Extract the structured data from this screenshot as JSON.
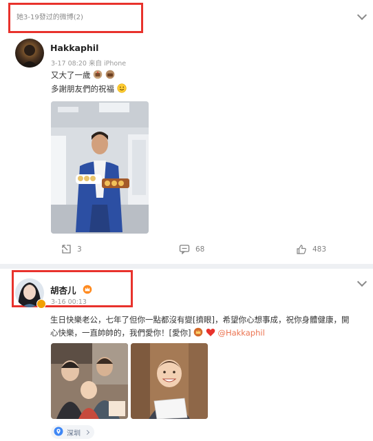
{
  "group": {
    "header": "她3-19發过的微博(2)"
  },
  "post1": {
    "username": "Hakkaphil",
    "meta": "3-17 08:20  来自 iPhone",
    "line1": "又大了一歲",
    "line2": "多謝朋友們的祝福",
    "repost_count": "3",
    "comment_count": "68",
    "like_count": "483"
  },
  "post2": {
    "username": "胡杏儿",
    "meta": "3-16 00:13",
    "line1": "生日快樂老公，七年了但你一點都沒有變[擠眼]，希望你心想事成，祝你身體健康，開",
    "line2_text": "心快樂，一直帥帥的，我們愛你！[愛你]",
    "mention": "@Hakkaphil",
    "location": "深圳"
  },
  "colors": {
    "highlight": "#e8322c",
    "mention": "#eb7350",
    "muted": "#999999"
  }
}
